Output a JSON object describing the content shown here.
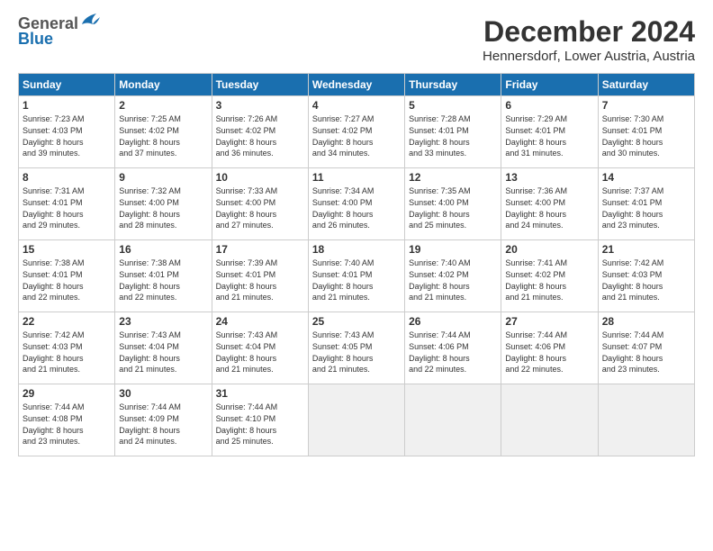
{
  "header": {
    "logo_general": "General",
    "logo_blue": "Blue",
    "month_title": "December 2024",
    "subtitle": "Hennersdorf, Lower Austria, Austria"
  },
  "weekdays": [
    "Sunday",
    "Monday",
    "Tuesday",
    "Wednesday",
    "Thursday",
    "Friday",
    "Saturday"
  ],
  "weeks": [
    [
      {
        "day": 1,
        "lines": [
          "Sunrise: 7:23 AM",
          "Sunset: 4:03 PM",
          "Daylight: 8 hours",
          "and 39 minutes."
        ]
      },
      {
        "day": 2,
        "lines": [
          "Sunrise: 7:25 AM",
          "Sunset: 4:02 PM",
          "Daylight: 8 hours",
          "and 37 minutes."
        ]
      },
      {
        "day": 3,
        "lines": [
          "Sunrise: 7:26 AM",
          "Sunset: 4:02 PM",
          "Daylight: 8 hours",
          "and 36 minutes."
        ]
      },
      {
        "day": 4,
        "lines": [
          "Sunrise: 7:27 AM",
          "Sunset: 4:02 PM",
          "Daylight: 8 hours",
          "and 34 minutes."
        ]
      },
      {
        "day": 5,
        "lines": [
          "Sunrise: 7:28 AM",
          "Sunset: 4:01 PM",
          "Daylight: 8 hours",
          "and 33 minutes."
        ]
      },
      {
        "day": 6,
        "lines": [
          "Sunrise: 7:29 AM",
          "Sunset: 4:01 PM",
          "Daylight: 8 hours",
          "and 31 minutes."
        ]
      },
      {
        "day": 7,
        "lines": [
          "Sunrise: 7:30 AM",
          "Sunset: 4:01 PM",
          "Daylight: 8 hours",
          "and 30 minutes."
        ]
      }
    ],
    [
      {
        "day": 8,
        "lines": [
          "Sunrise: 7:31 AM",
          "Sunset: 4:01 PM",
          "Daylight: 8 hours",
          "and 29 minutes."
        ]
      },
      {
        "day": 9,
        "lines": [
          "Sunrise: 7:32 AM",
          "Sunset: 4:00 PM",
          "Daylight: 8 hours",
          "and 28 minutes."
        ]
      },
      {
        "day": 10,
        "lines": [
          "Sunrise: 7:33 AM",
          "Sunset: 4:00 PM",
          "Daylight: 8 hours",
          "and 27 minutes."
        ]
      },
      {
        "day": 11,
        "lines": [
          "Sunrise: 7:34 AM",
          "Sunset: 4:00 PM",
          "Daylight: 8 hours",
          "and 26 minutes."
        ]
      },
      {
        "day": 12,
        "lines": [
          "Sunrise: 7:35 AM",
          "Sunset: 4:00 PM",
          "Daylight: 8 hours",
          "and 25 minutes."
        ]
      },
      {
        "day": 13,
        "lines": [
          "Sunrise: 7:36 AM",
          "Sunset: 4:00 PM",
          "Daylight: 8 hours",
          "and 24 minutes."
        ]
      },
      {
        "day": 14,
        "lines": [
          "Sunrise: 7:37 AM",
          "Sunset: 4:01 PM",
          "Daylight: 8 hours",
          "and 23 minutes."
        ]
      }
    ],
    [
      {
        "day": 15,
        "lines": [
          "Sunrise: 7:38 AM",
          "Sunset: 4:01 PM",
          "Daylight: 8 hours",
          "and 22 minutes."
        ]
      },
      {
        "day": 16,
        "lines": [
          "Sunrise: 7:38 AM",
          "Sunset: 4:01 PM",
          "Daylight: 8 hours",
          "and 22 minutes."
        ]
      },
      {
        "day": 17,
        "lines": [
          "Sunrise: 7:39 AM",
          "Sunset: 4:01 PM",
          "Daylight: 8 hours",
          "and 21 minutes."
        ]
      },
      {
        "day": 18,
        "lines": [
          "Sunrise: 7:40 AM",
          "Sunset: 4:01 PM",
          "Daylight: 8 hours",
          "and 21 minutes."
        ]
      },
      {
        "day": 19,
        "lines": [
          "Sunrise: 7:40 AM",
          "Sunset: 4:02 PM",
          "Daylight: 8 hours",
          "and 21 minutes."
        ]
      },
      {
        "day": 20,
        "lines": [
          "Sunrise: 7:41 AM",
          "Sunset: 4:02 PM",
          "Daylight: 8 hours",
          "and 21 minutes."
        ]
      },
      {
        "day": 21,
        "lines": [
          "Sunrise: 7:42 AM",
          "Sunset: 4:03 PM",
          "Daylight: 8 hours",
          "and 21 minutes."
        ]
      }
    ],
    [
      {
        "day": 22,
        "lines": [
          "Sunrise: 7:42 AM",
          "Sunset: 4:03 PM",
          "Daylight: 8 hours",
          "and 21 minutes."
        ]
      },
      {
        "day": 23,
        "lines": [
          "Sunrise: 7:43 AM",
          "Sunset: 4:04 PM",
          "Daylight: 8 hours",
          "and 21 minutes."
        ]
      },
      {
        "day": 24,
        "lines": [
          "Sunrise: 7:43 AM",
          "Sunset: 4:04 PM",
          "Daylight: 8 hours",
          "and 21 minutes."
        ]
      },
      {
        "day": 25,
        "lines": [
          "Sunrise: 7:43 AM",
          "Sunset: 4:05 PM",
          "Daylight: 8 hours",
          "and 21 minutes."
        ]
      },
      {
        "day": 26,
        "lines": [
          "Sunrise: 7:44 AM",
          "Sunset: 4:06 PM",
          "Daylight: 8 hours",
          "and 22 minutes."
        ]
      },
      {
        "day": 27,
        "lines": [
          "Sunrise: 7:44 AM",
          "Sunset: 4:06 PM",
          "Daylight: 8 hours",
          "and 22 minutes."
        ]
      },
      {
        "day": 28,
        "lines": [
          "Sunrise: 7:44 AM",
          "Sunset: 4:07 PM",
          "Daylight: 8 hours",
          "and 23 minutes."
        ]
      }
    ],
    [
      {
        "day": 29,
        "lines": [
          "Sunrise: 7:44 AM",
          "Sunset: 4:08 PM",
          "Daylight: 8 hours",
          "and 23 minutes."
        ]
      },
      {
        "day": 30,
        "lines": [
          "Sunrise: 7:44 AM",
          "Sunset: 4:09 PM",
          "Daylight: 8 hours",
          "and 24 minutes."
        ]
      },
      {
        "day": 31,
        "lines": [
          "Sunrise: 7:44 AM",
          "Sunset: 4:10 PM",
          "Daylight: 8 hours",
          "and 25 minutes."
        ]
      },
      null,
      null,
      null,
      null
    ]
  ]
}
